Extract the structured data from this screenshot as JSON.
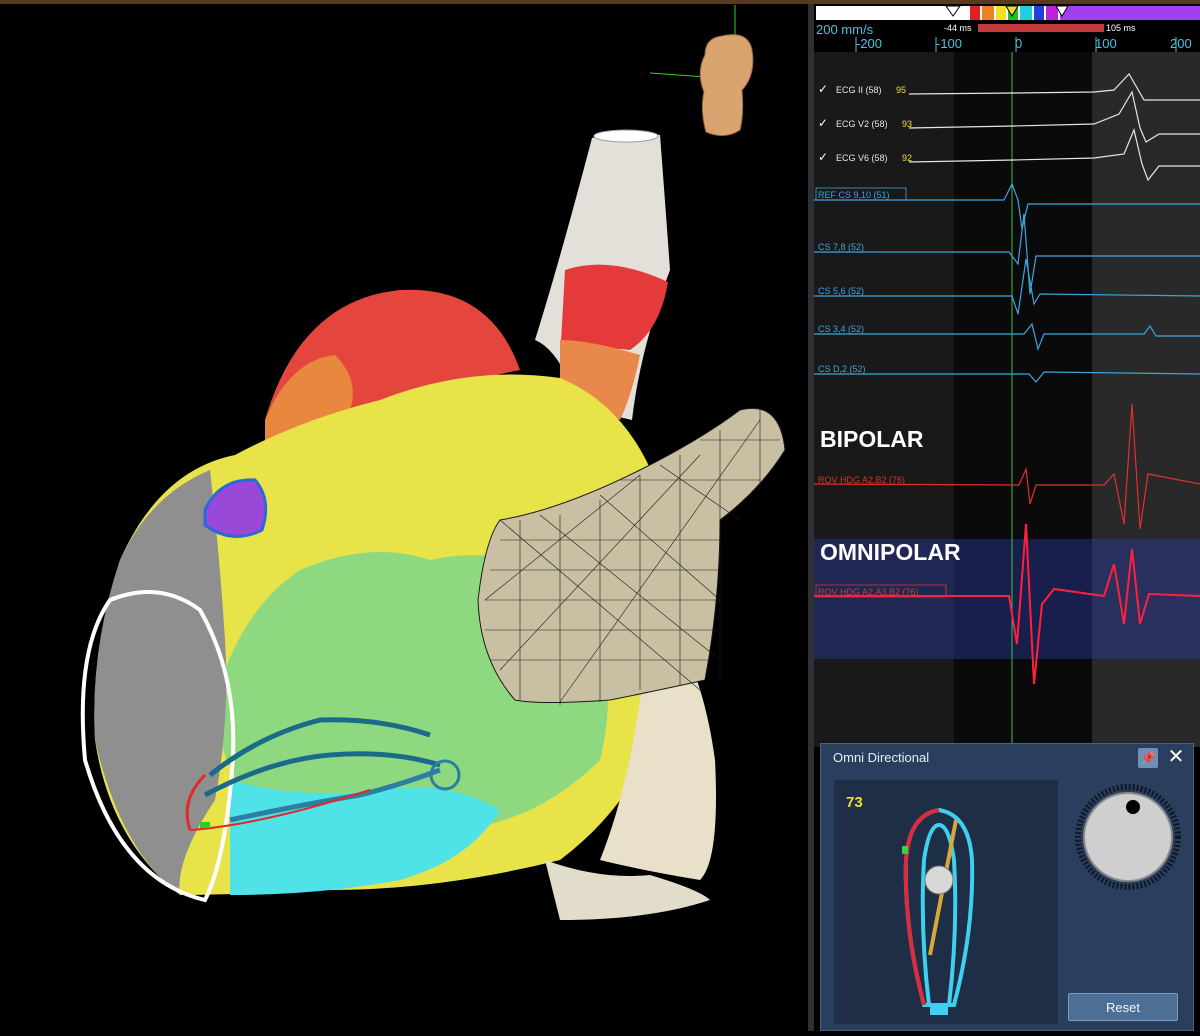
{
  "speed": {
    "label": "200 mm/s"
  },
  "timeline": {
    "ticks": [
      "-200",
      "-100",
      "0",
      "100",
      "200"
    ],
    "marker_left": "-44 ms",
    "marker_right": "105 ms"
  },
  "channels": [
    {
      "label": "ECG II (58)",
      "value": "95"
    },
    {
      "label": "ECG V2 (58)",
      "value": "93"
    },
    {
      "label": "ECG V6 (58)",
      "value": "92"
    },
    {
      "label": "REF CS 9,10 (51)"
    },
    {
      "label": "CS 7,8 (52)"
    },
    {
      "label": "CS 5,6 (52)"
    },
    {
      "label": "CS 3,4 (52)"
    },
    {
      "label": "CS D,2 (52)"
    },
    {
      "label": "ROV HDG A2,B2 (76)"
    },
    {
      "label": "ROV HDG   A2,A3,B2 (76)"
    }
  ],
  "section_labels": {
    "bipolar": "BIPOLAR",
    "omnipolar": "OMNIPOLAR"
  },
  "omni_panel": {
    "title": "Omni Directional",
    "value": "73",
    "reset_label": "Reset"
  },
  "colors": {
    "cs": "#3aa6e0",
    "ecg": "#e6e6e6",
    "rov": "#e03030",
    "value": "#f0e030",
    "panel": "#2a3f5e"
  }
}
